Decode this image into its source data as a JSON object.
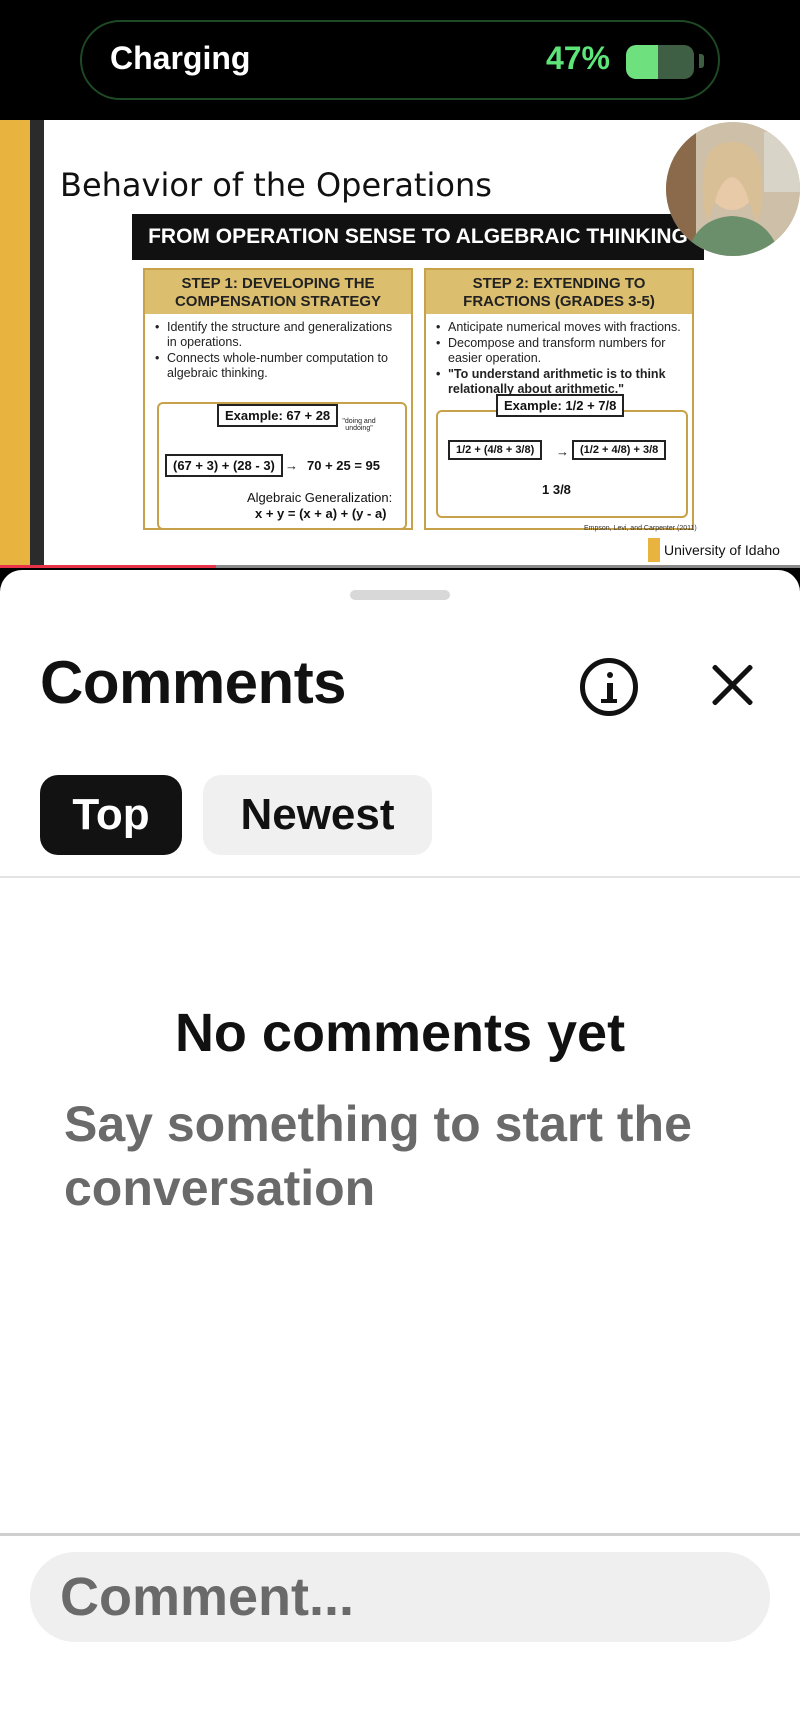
{
  "status": {
    "charging_label": "Charging",
    "battery_percent_label": "47%",
    "battery_level": 0.47
  },
  "video": {
    "slide_title": "Behavior of the Operations",
    "banner": "FROM OPERATION SENSE TO ALGEBRAIC THINKING",
    "step1": {
      "heading": "STEP 1: DEVELOPING THE COMPENSATION STRATEGY",
      "bullets": [
        "Identify the structure and generalizations in operations.",
        "Connects whole-number computation to algebraic thinking."
      ],
      "example": "Example: 67 + 28",
      "note": "\"doing and undoing\"",
      "expression": "(67 + 3) + (28 - 3)",
      "result": "70 + 25 = 95",
      "generalization_label": "Algebraic Generalization:",
      "generalization": "x + y = (x + a) + (y - a)"
    },
    "step2": {
      "heading": "STEP 2: EXTENDING TO FRACTIONS (GRADES 3-5)",
      "bullets": [
        "Anticipate numerical moves with fractions.",
        "Decompose and transform numbers for easier operation."
      ],
      "quote": "\"To understand arithmetic is to think relationally about arithmetic.\"",
      "example": "Example: 1/2 + 7/8",
      "expression_left": "1/2 + (4/8 + 3/8)",
      "expression_right": "(1/2 + 4/8) + 3/8",
      "result": "1 3/8"
    },
    "citation": "Empson, Levi, and Carpenter (2011)",
    "university": "University of Idaho",
    "progress": 0.27
  },
  "sheet": {
    "title": "Comments",
    "tabs": [
      {
        "label": "Top",
        "selected": true
      },
      {
        "label": "Newest",
        "selected": false
      }
    ],
    "empty_title": "No comments yet",
    "empty_subtitle": "Say something to start the conversation",
    "comment_placeholder": "Comment..."
  }
}
